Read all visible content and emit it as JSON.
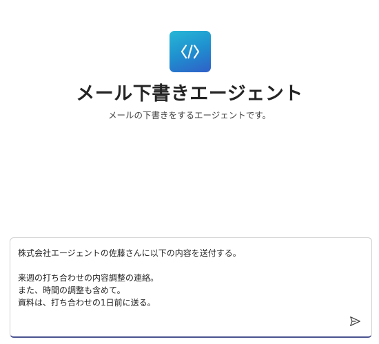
{
  "agent": {
    "title": "メール下書きエージェント",
    "subtitle": "メールの下書きをするエージェントです。",
    "logo_icon": "code-slashes-icon",
    "logo_gradient": [
      "#27b7d6",
      "#2f5fc8"
    ]
  },
  "composer": {
    "message": "株式会社エージェントの佐藤さんに以下の内容を送付する。\n\n来週の打ち合わせの内容調整の連絡。\nまた、時間の調整も含めて。\n資料は、打ち合わせの1日前に送る。",
    "send_icon": "send-icon",
    "focus_color": "#4a5290"
  }
}
